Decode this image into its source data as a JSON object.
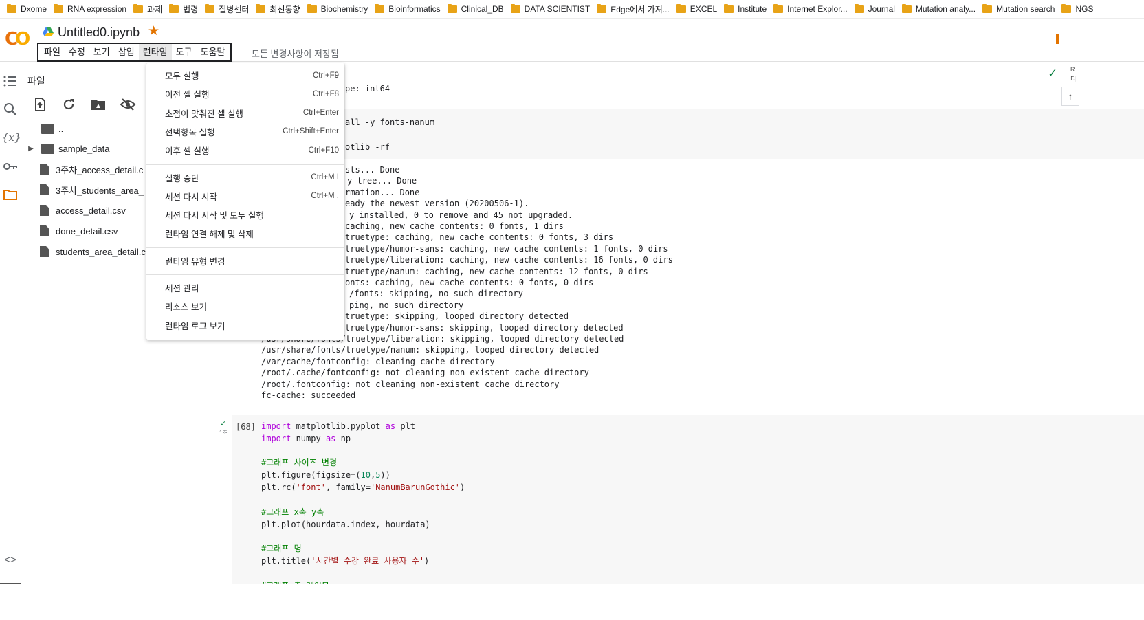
{
  "bookmarks": [
    "Dxome",
    "RNA expression",
    "과제",
    "법령",
    "질병센터",
    "최신동향",
    "Biochemistry",
    "Bioinformatics",
    "Clinical_DB",
    "DATA SCIENTIST",
    "Edge에서 가져...",
    "EXCEL",
    "Institute",
    "Internet Explor...",
    "Journal",
    "Mutation analy...",
    "Mutation search",
    "NGS"
  ],
  "header": {
    "logo": "CO",
    "title": "Untitled0.ipynb",
    "star": "★",
    "menus": [
      "파일",
      "수정",
      "보기",
      "삽입",
      "런타임",
      "도구",
      "도움말"
    ],
    "active_menu": "런타임",
    "saved_status": "모든 변경사항이 저장됨"
  },
  "sidebar": {
    "title": "파일",
    "files": [
      {
        "name": "..",
        "type": "parent"
      },
      {
        "name": "sample_data",
        "type": "folder"
      },
      {
        "name": "3주차_access_detail.c",
        "type": "file"
      },
      {
        "name": "3주차_students_area_",
        "type": "file"
      },
      {
        "name": "access_detail.csv",
        "type": "file"
      },
      {
        "name": "done_detail.csv",
        "type": "file"
      },
      {
        "name": "students_area_detail.c",
        "type": "file"
      }
    ]
  },
  "runtime_menu": {
    "groups": [
      [
        {
          "label": "모두 실행",
          "shortcut": "Ctrl+F9"
        },
        {
          "label": "이전 셀 실행",
          "shortcut": "Ctrl+F8"
        },
        {
          "label": "초점이 맞춰진 셀 실행",
          "shortcut": "Ctrl+Enter"
        },
        {
          "label": "선택항목 실행",
          "shortcut": "Ctrl+Shift+Enter"
        },
        {
          "label": "이후 셀 실행",
          "shortcut": "Ctrl+F10"
        }
      ],
      [
        {
          "label": "실행 중단",
          "shortcut": "Ctrl+M I"
        },
        {
          "label": "세션 다시 시작",
          "shortcut": "Ctrl+M ."
        },
        {
          "label": "세션 다시 시작 및 모두 실행",
          "shortcut": ""
        },
        {
          "label": "런타임 연결 해제 및 삭제",
          "shortcut": ""
        }
      ],
      [
        {
          "label": "런타임 유형 변경",
          "shortcut": ""
        }
      ],
      [
        {
          "label": "세션 관리",
          "shortcut": ""
        },
        {
          "label": "리소스 보기",
          "shortcut": ""
        },
        {
          "label": "런타임 로그 보기",
          "shortcut": ""
        }
      ]
    ]
  },
  "notebook": {
    "top_output": "pe: int64",
    "cell2_code": [
      "all -y fonts-nanum",
      "",
      "otlib -rf"
    ],
    "cell2_output": [
      "sts... Done",
      "y tree... Done",
      "rmation... Done",
      "eady the newest version (20200506-1).",
      "y installed, 0 to remove and 45 not upgraded.",
      "caching, new cache contents: 0 fonts, 1 dirs",
      "truetype: caching, new cache contents: 0 fonts, 3 dirs",
      "truetype/humor-sans: caching, new cache contents: 1 fonts, 0 dirs",
      "truetype/liberation: caching, new cache contents: 16 fonts, 0 dirs",
      "truetype/nanum: caching, new cache contents: 12 fonts, 0 dirs",
      "onts: caching, new cache contents: 0 fonts, 0 dirs",
      "/fonts: skipping, no such directory",
      "ping, no such directory",
      "truetype: skipping, looped directory detected",
      "truetype/humor-sans: skipping, looped directory detected",
      "/usr/share/fonts/truetype/liberation: skipping, looped directory detected",
      "/usr/share/fonts/truetype/nanum: skipping, looped directory detected",
      "/var/cache/fontconfig: cleaning cache directory",
      "/root/.cache/fontconfig: not cleaning non-existent cache directory",
      "/root/.fontconfig: not cleaning non-existent cache directory",
      "fc-cache: succeeded"
    ],
    "cell3": {
      "exec_count": "[68]",
      "exec_time": "1초",
      "comments": [
        "#그래프 사이즈 변경",
        "#그래프 x축 y축",
        "#그래프 명",
        "#그래프 축 레이블"
      ],
      "line1": {
        "kw1": "import",
        "mod": " matplotlib.pyplot ",
        "kw2": "as",
        "alias": " plt"
      },
      "line2": {
        "kw1": "import",
        "mod": " numpy ",
        "kw2": "as",
        "alias": " np"
      },
      "figure": {
        "pre": "plt.figure(figsize=(",
        "a": "10",
        "sep": ",",
        "b": "5",
        "post": "))"
      },
      "rc": {
        "pre": "plt.rc(",
        "s1": "'font'",
        "mid": ", family=",
        "s2": "'NanumBarunGothic'",
        "post": ")"
      },
      "plot": "plt.plot(hourdata.index, hourdata)",
      "title": {
        "pre": "plt.title(",
        "s": "'시간별 수강 완료 사용자 수'",
        "post": ")"
      }
    }
  }
}
